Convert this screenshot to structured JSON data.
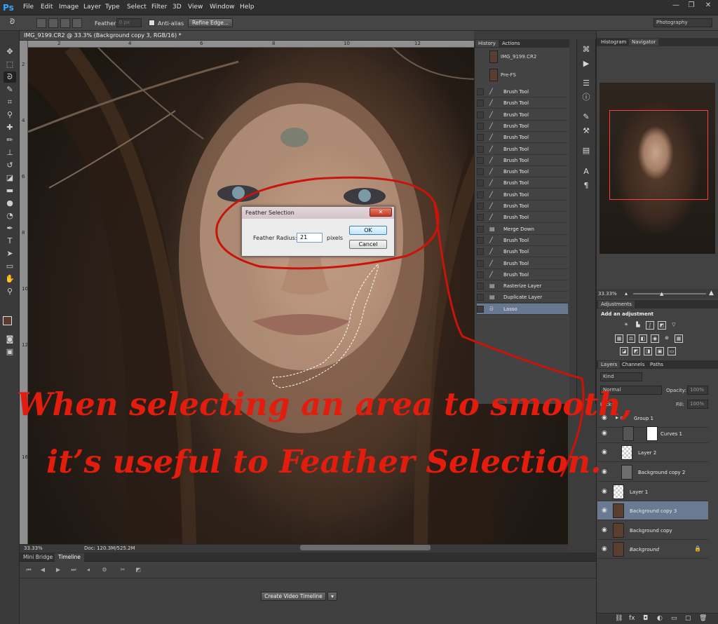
{
  "app": {
    "logo": "Ps"
  },
  "menu": [
    "File",
    "Edit",
    "Image",
    "Layer",
    "Type",
    "Select",
    "Filter",
    "3D",
    "View",
    "Window",
    "Help"
  ],
  "window_controls": {
    "minimize": "—",
    "restore": "❐",
    "close": "✕"
  },
  "options_bar": {
    "feather_label": "Feather:",
    "feather_value": "0 px",
    "antialias_label": "Anti-alias",
    "refine_edge_label": "Refine Edge...",
    "workspace": "Photography"
  },
  "document": {
    "tab_title": "IMG_9199.CR2 @ 33.3% (Background copy 3, RGB/16) *",
    "zoom": "33.33%",
    "doc_size": "Doc: 120.3M/525.2M",
    "ruler_h": [
      "2",
      "4",
      "6",
      "8",
      "10",
      "12"
    ],
    "ruler_v": [
      "2",
      "4",
      "6",
      "8",
      "10",
      "12",
      "14",
      "16"
    ]
  },
  "history": {
    "tabs": [
      "History",
      "Actions"
    ],
    "snapshots": [
      "IMG_9199.CR2",
      "Pre-FS"
    ],
    "states": [
      {
        "icon": "brush-icon",
        "label": "Brush Tool"
      },
      {
        "icon": "brush-icon",
        "label": "Brush Tool"
      },
      {
        "icon": "brush-icon",
        "label": "Brush Tool"
      },
      {
        "icon": "brush-icon",
        "label": "Brush Tool"
      },
      {
        "icon": "brush-icon",
        "label": "Brush Tool"
      },
      {
        "icon": "brush-icon",
        "label": "Brush Tool"
      },
      {
        "icon": "brush-icon",
        "label": "Brush Tool"
      },
      {
        "icon": "brush-icon",
        "label": "Brush Tool"
      },
      {
        "icon": "brush-icon",
        "label": "Brush Tool"
      },
      {
        "icon": "brush-icon",
        "label": "Brush Tool"
      },
      {
        "icon": "brush-icon",
        "label": "Brush Tool"
      },
      {
        "icon": "brush-icon",
        "label": "Brush Tool"
      },
      {
        "icon": "layer-icon",
        "label": "Merge Down"
      },
      {
        "icon": "brush-icon",
        "label": "Brush Tool"
      },
      {
        "icon": "brush-icon",
        "label": "Brush Tool"
      },
      {
        "icon": "brush-icon",
        "label": "Brush Tool"
      },
      {
        "icon": "brush-icon",
        "label": "Brush Tool"
      },
      {
        "icon": "layer-icon",
        "label": "Rasterize Layer"
      },
      {
        "icon": "layer-icon",
        "label": "Duplicate Layer"
      },
      {
        "icon": "lasso-icon",
        "label": "Lasso"
      }
    ],
    "active_state": "Lasso"
  },
  "navigator": {
    "tabs": [
      "Histogram",
      "Navigator"
    ],
    "zoom": "33.33%"
  },
  "adjustments": {
    "tab": "Adjustments",
    "heading": "Add an adjustment"
  },
  "layers": {
    "tabs": [
      "Layers",
      "Channels",
      "Paths"
    ],
    "filter": "Kind",
    "blend_mode": "Normal",
    "opacity_label": "Opacity:",
    "opacity": "100%",
    "lock_label": "Lock:",
    "fill_label": "Fill:",
    "fill": "100%",
    "items": [
      {
        "name": "Group 1",
        "kind": "group"
      },
      {
        "name": "Curves 1",
        "kind": "adjustment"
      },
      {
        "name": "Layer 2",
        "kind": "transparent"
      },
      {
        "name": "Background copy 2",
        "kind": "gray"
      },
      {
        "name": "Layer 1",
        "kind": "transparent"
      },
      {
        "name": "Background copy 3",
        "kind": "photo",
        "active": true
      },
      {
        "name": "Background copy",
        "kind": "photo"
      },
      {
        "name": "Background",
        "kind": "photo",
        "locked": true
      }
    ]
  },
  "bottom": {
    "tabs": [
      "Mini Bridge",
      "Timeline"
    ],
    "create_button": "Create Video Timeline"
  },
  "dialog": {
    "title": "Feather Selection",
    "close": "✕",
    "label": "Feather Radius:",
    "value": "21",
    "unit": "pixels",
    "ok": "OK",
    "cancel": "Cancel"
  },
  "annotation": {
    "line1": "When selecting an area to smooth,",
    "line2": "it’s useful to Feather Selection.",
    "color": "#e21d0e"
  }
}
